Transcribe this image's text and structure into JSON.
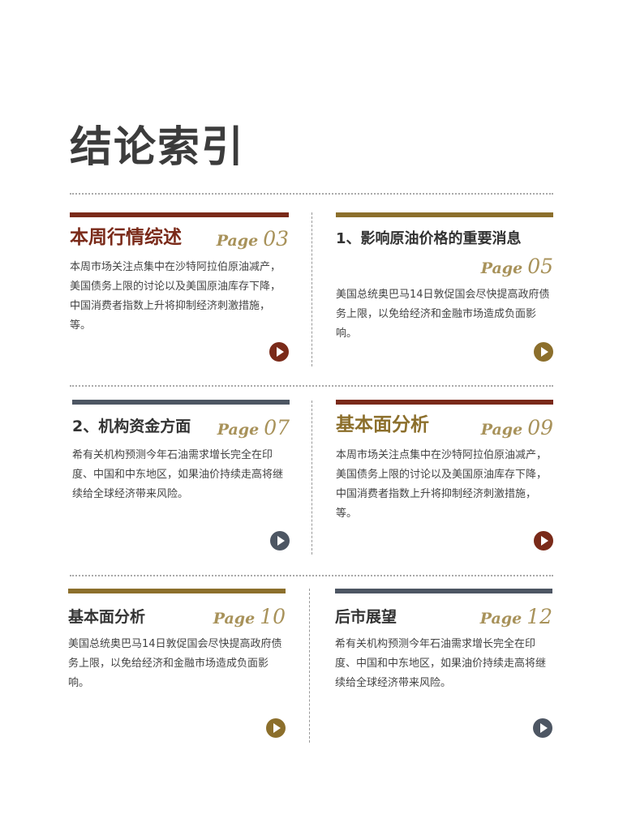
{
  "page": {
    "title": "结论索引"
  },
  "cards": [
    {
      "title": "本周行情综述",
      "page_label": "Page",
      "page_num": "03",
      "body": "本周市场关注点集中在沙特阿拉伯原油减产，美国债务上限的讨论以及美国原油库存下降，中国消费者指数上升将抑制经济刺激措施，等。",
      "accent": "#7a2a19",
      "title_color": "#7a2a19",
      "button_color": "#7a2a19"
    },
    {
      "title": "1、影响原油价格的重要消息",
      "page_label": "Page",
      "page_num": "05",
      "body": "美国总统奥巴马14日敦促国会尽快提高政府债务上限，以免给经济和金融市场造成负面影响。",
      "accent": "#8c6f2c",
      "title_color": "#333333",
      "button_color": "#8c6f2c"
    },
    {
      "title": "2、机构资金方面",
      "page_label": "Page",
      "page_num": "07",
      "body": "希有关机构预测今年石油需求增长完全在印度、中国和中东地区，如果油价持续走高将继续给全球经济带来风险。",
      "accent": "#4d5663",
      "title_color": "#333333",
      "button_color": "#4d5663"
    },
    {
      "title": "基本面分析",
      "page_label": "Page",
      "page_num": "09",
      "body": "本周市场关注点集中在沙特阿拉伯原油减产，美国债务上限的讨论以及美国原油库存下降，中国消费者指数上升将抑制经济刺激措施，等。",
      "accent": "#7a2a19",
      "title_color": "#8c6f2c",
      "button_color": "#7a2a19"
    },
    {
      "title": "基本面分析",
      "page_label": "Page",
      "page_num": "10",
      "body": "美国总统奥巴马14日敦促国会尽快提高政府债务上限，以免给经济和金融市场造成负面影响。",
      "accent": "#8c6f2c",
      "title_color": "#333333",
      "button_color": "#8c6f2c"
    },
    {
      "title": "后市展望",
      "page_label": "Page",
      "page_num": "12",
      "body": "希有关机构预测今年石油需求增长完全在印度、中国和中东地区，如果油价持续走高将继续给全球经济带来风险。",
      "accent": "#4d5663",
      "title_color": "#333333",
      "button_color": "#4d5663"
    }
  ]
}
